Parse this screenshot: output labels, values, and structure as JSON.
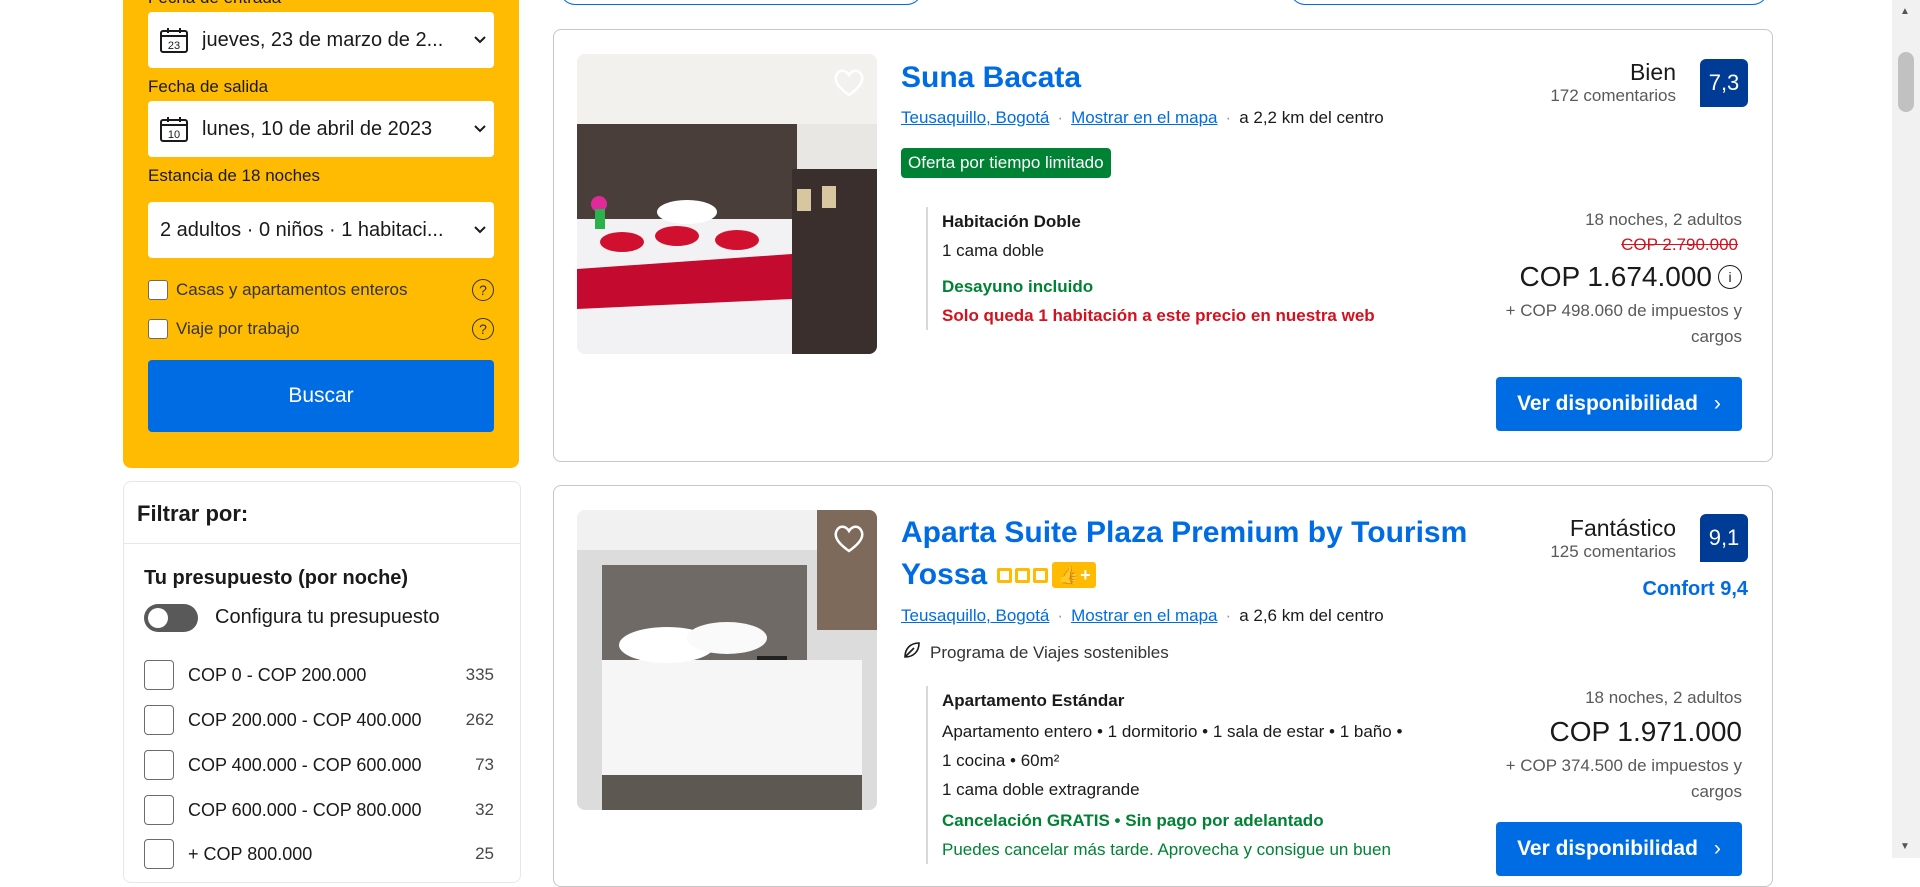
{
  "search": {
    "checkin_label": "Fecha de entrada",
    "checkin_value": "jueves, 23 de marzo de 2...",
    "checkin_cal_day": "23",
    "checkout_label": "Fecha de salida",
    "checkout_value": "lunes, 10 de abril de 2023",
    "checkout_cal_day": "10",
    "stay_label": "Estancia de 18 noches",
    "guests_value": "2 adultos · 0 niños · 1 habitaci...",
    "opt_entire": "Casas y apartamentos enteros",
    "opt_work": "Viaje por trabajo",
    "search_button": "Buscar"
  },
  "filters": {
    "title": "Filtrar por:",
    "budget_title": "Tu presupuesto (por noche)",
    "budget_toggle_label": "Configura tu presupuesto",
    "ranges": [
      {
        "label": "COP 0 - COP 200.000",
        "count": "335"
      },
      {
        "label": "COP 200.000 - COP 400.000",
        "count": "262"
      },
      {
        "label": "COP 400.000 - COP 600.000",
        "count": "73"
      },
      {
        "label": "COP 600.000 - COP 800.000",
        "count": "32"
      },
      {
        "label": "+ COP 800.000",
        "count": "25"
      }
    ]
  },
  "hotels": [
    {
      "name": "Suna Bacata",
      "district": "Teusaquillo, Bogotá",
      "map_link": "Mostrar en el mapa",
      "distance": "a 2,2 km del centro",
      "deal_badge": "Oferta por tiempo limitado",
      "score_word": "Bien",
      "reviews": "172 comentarios",
      "score": "7,3",
      "room_type": "Habitación Doble",
      "bed": "1 cama doble",
      "breakfast": "Desayuno incluido",
      "scarcity": "Solo queda 1 habitación a este precio en nuestra web",
      "stay_info": "18 noches, 2 adultos",
      "old_price": "COP 2.790.000",
      "price": "COP 1.674.000",
      "taxes": "+ COP 498.060 de impuestos y",
      "taxes_2": "cargos",
      "cta": "Ver disponibilidad"
    },
    {
      "name": "Aparta Suite Plaza Premium by Tourism",
      "name_2": "Yossa",
      "district": "Teusaquillo, Bogotá",
      "map_link": "Mostrar en el mapa",
      "distance": "a 2,6 km del centro",
      "sustainable": "Programa de Viajes sostenibles",
      "score_word": "Fantástico",
      "reviews": "125 comentarios",
      "score": "9,1",
      "comfort": "Confort 9,4",
      "room_type": "Apartamento Estándar",
      "details": "Apartamento entero • 1 dormitorio • 1 sala de estar • 1 baño •",
      "details_2": "1 cocina • 60m²",
      "bed": "1 cama doble extragrande",
      "cancel": "Cancelación GRATIS • Sin pago por adelantado",
      "cancel_note": "Puedes cancelar más tarde. Aprovecha y consigue un buen",
      "stay_info": "18 noches, 2 adultos",
      "price": "COP 1.971.000",
      "taxes": "+ COP 374.500 de impuestos y",
      "taxes_2": "cargos",
      "cta": "Ver disponibilidad"
    }
  ],
  "colors": {
    "brand_blue": "#006ce4",
    "search_yellow": "#febb02",
    "score_navy": "#003b95",
    "deal_green": "#008234",
    "alert_red": "#d4111e"
  }
}
